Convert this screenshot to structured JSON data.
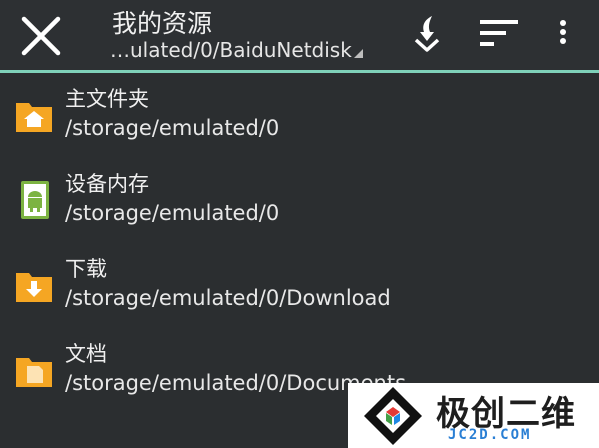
{
  "toolbar": {
    "title": "我的资源",
    "path": "…ulated/0/BaiduNetdisk",
    "icons": [
      "close-icon",
      "download-sort-icon",
      "sort-icon",
      "more-vert-icon"
    ]
  },
  "items": [
    {
      "name": "主文件夹",
      "path": "/storage/emulated/0",
      "icon": "home-folder-icon",
      "icon_color": "#f5a623"
    },
    {
      "name": "设备内存",
      "path": "/storage/emulated/0",
      "icon": "android-storage-icon",
      "icon_color": "#7cb342"
    },
    {
      "name": "下载",
      "path": "/storage/emulated/0/Download",
      "icon": "download-folder-icon",
      "icon_color": "#f5a623"
    },
    {
      "name": "文档",
      "path": "/storage/emulated/0/Documents",
      "icon": "document-folder-icon",
      "icon_color": "#f5a623"
    }
  ],
  "watermark": {
    "text_cn": "极创二维",
    "text_en": "JC2D.COM"
  },
  "colors": {
    "accent": "#7fd1b9",
    "background": "#2b2e30",
    "folder": "#f5a623",
    "android": "#7cb342"
  }
}
